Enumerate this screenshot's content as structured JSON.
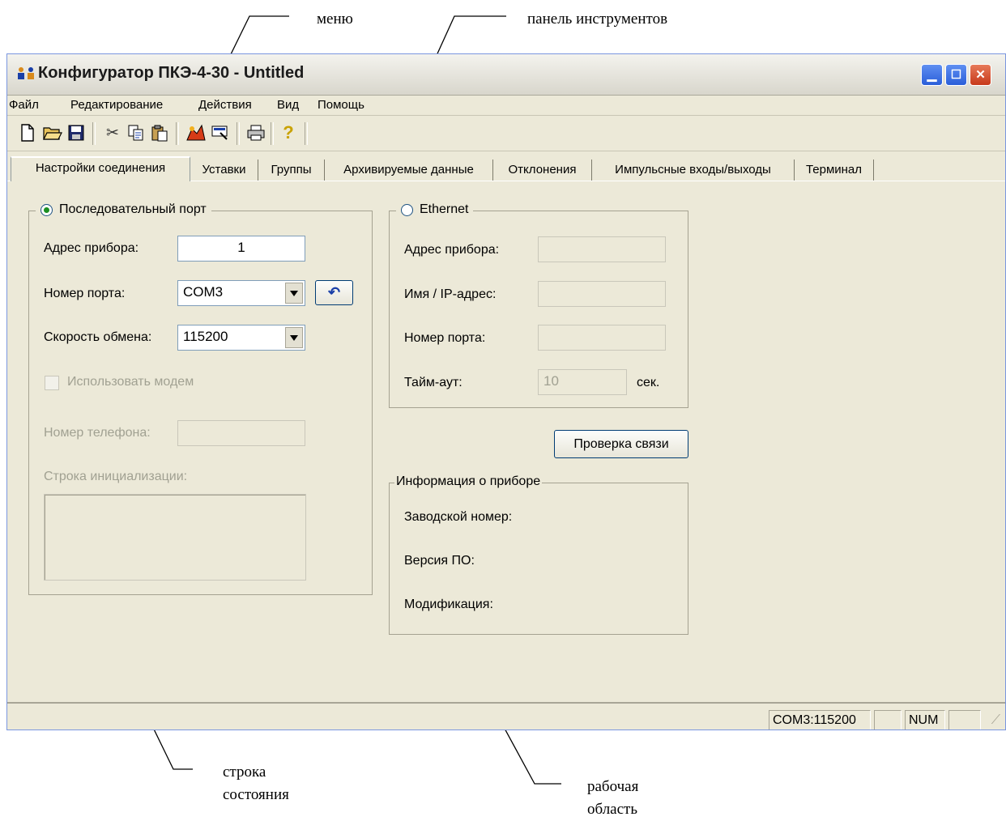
{
  "annotations": {
    "menu": "меню",
    "toolbar": "панель инструментов",
    "statusbar": "строка\nсостояния",
    "workarea": "рабочая\nобласть"
  },
  "window": {
    "title": "Конфигуратор ПКЭ-4-30 - Untitled"
  },
  "menubar": {
    "items": [
      "Файл",
      "Редактирование",
      "Действия",
      "Вид",
      "Помощь"
    ]
  },
  "toolbar": {
    "icons": [
      "new-file-icon",
      "open-folder-icon",
      "save-disk-icon",
      "cut-scissors-icon",
      "copy-icon",
      "paste-icon",
      "read-device-icon",
      "write-device-icon",
      "print-icon",
      "help-icon"
    ]
  },
  "tabs": [
    "Настройки соединения",
    "Уставки",
    "Группы",
    "Архивируемые данные",
    "Отклонения",
    "Импульсные входы/выходы",
    "Терминал"
  ],
  "serial": {
    "title": "Последовательный порт",
    "address_label": "Адрес прибора:",
    "address_value": "1",
    "port_label": "Номер порта:",
    "port_value": "COM3",
    "speed_label": "Скорость обмена:",
    "speed_value": "115200",
    "modem_label": "Использовать модем",
    "phone_label": "Номер телефона:",
    "init_label": "Строка инициализации:"
  },
  "ethernet": {
    "title": "Ethernet",
    "address_label": "Адрес прибора:",
    "ip_label": "Имя / IP-адрес:",
    "port_label": "Номер порта:",
    "timeout_label": "Тайм-аут:",
    "timeout_value": "10",
    "timeout_unit": "сек."
  },
  "check_button": "Проверка связи",
  "device_info": {
    "title": "Информация о приборе",
    "serial_label": "Заводской номер:",
    "version_label": "Версия ПО:",
    "modification_label": "Модификация:"
  },
  "statusbar": {
    "connection": "COM3:115200",
    "num": "NUM"
  }
}
